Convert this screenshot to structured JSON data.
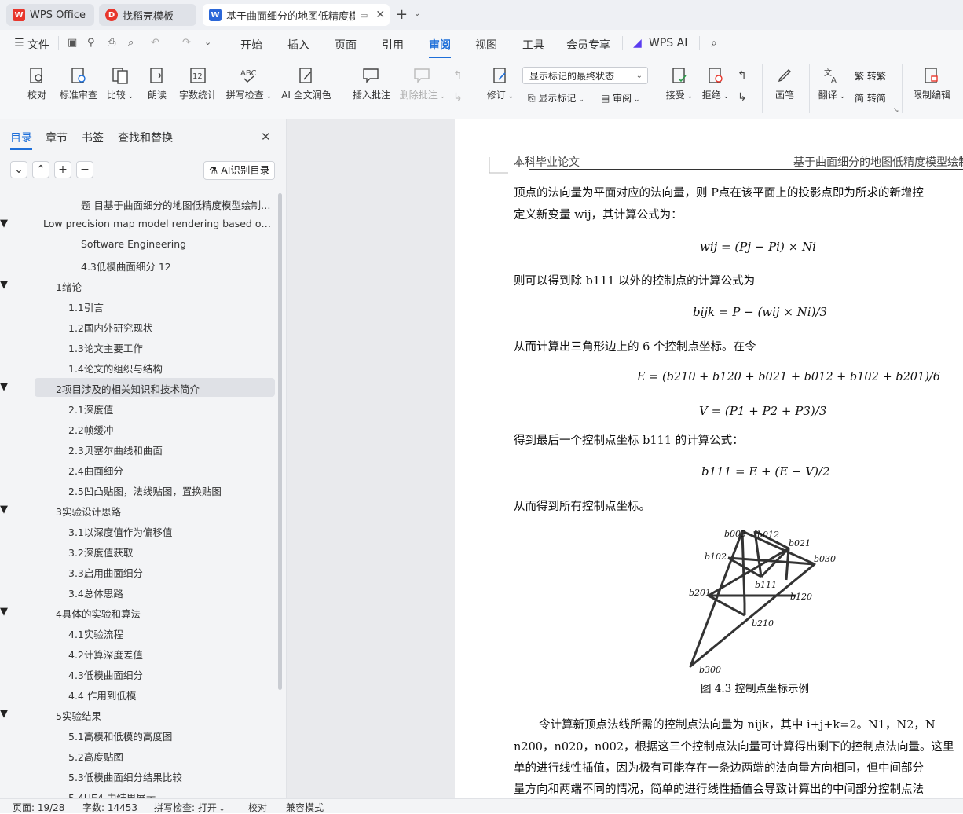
{
  "tabs": [
    {
      "label": "WPS Office",
      "icon": "wps-logo-icon"
    },
    {
      "label": "找稻壳模板",
      "icon": "docer-icon"
    },
    {
      "label": "基于曲面细分的地图低精度模",
      "icon": "word-doc-icon"
    }
  ],
  "menubar": {
    "file_label": "文件",
    "items": [
      "开始",
      "插入",
      "页面",
      "引用",
      "审阅",
      "视图",
      "工具",
      "会员专享"
    ],
    "active": "审阅",
    "wps_ai": "WPS AI"
  },
  "ribbon": {
    "proofread": "校对",
    "standard_review": "标准审查",
    "compare": "比较",
    "read_aloud": "朗读",
    "word_count": "字数统计",
    "spell_check": "拼写检查",
    "ai_polish": "AI 全文润色",
    "insert_comment": "插入批注",
    "delete_comment": "删除批注",
    "track_changes": "修订",
    "show_markup_select": "显示标记的最终状态",
    "show_markup": "显示标记",
    "review": "审阅",
    "accept": "接受",
    "reject": "拒绝",
    "pen": "画笔",
    "translate": "翻译",
    "to_traditional": "转繁",
    "to_simplified": "转简",
    "restrict_edit": "限制编辑"
  },
  "panel": {
    "tabs": [
      "目录",
      "章节",
      "书签",
      "查找和替换"
    ],
    "ai_toc": "AI识别目录",
    "toc": [
      {
        "label": "题 目基于曲面细分的地图低精度模型绘制及...",
        "level": 2,
        "arrow": false
      },
      {
        "label": "Low precision map model rendering based on s...",
        "level": 0,
        "arrow": true
      },
      {
        "label": "Software Engineering",
        "level": 2,
        "arrow": false
      },
      {
        "label": "4.3低模曲面细分 12",
        "level": 2,
        "arrow": false
      },
      {
        "label": "1绪论",
        "level": 1,
        "arrow": true
      },
      {
        "label": "1.1引言",
        "level": 3,
        "arrow": false
      },
      {
        "label": "1.2国内外研究现状",
        "level": 3,
        "arrow": false
      },
      {
        "label": "1.3论文主要工作",
        "level": 3,
        "arrow": false
      },
      {
        "label": "1.4论文的组织与结构",
        "level": 3,
        "arrow": false
      },
      {
        "label": "2项目涉及的相关知识和技术简介",
        "level": 1,
        "arrow": true
      },
      {
        "label": "2.1深度值",
        "level": 3,
        "arrow": false
      },
      {
        "label": "2.2帧缓冲",
        "level": 3,
        "arrow": false
      },
      {
        "label": "2.3贝塞尔曲线和曲面",
        "level": 3,
        "arrow": false
      },
      {
        "label": "2.4曲面细分",
        "level": 3,
        "arrow": false
      },
      {
        "label": "2.5凹凸贴图，法线贴图，置换贴图",
        "level": 3,
        "arrow": false
      },
      {
        "label": "3实验设计思路",
        "level": 1,
        "arrow": true
      },
      {
        "label": "3.1以深度值作为偏移值",
        "level": 3,
        "arrow": false
      },
      {
        "label": "3.2深度值获取",
        "level": 3,
        "arrow": false
      },
      {
        "label": "3.3启用曲面细分",
        "level": 3,
        "arrow": false
      },
      {
        "label": "3.4总体思路",
        "level": 3,
        "arrow": false
      },
      {
        "label": "4具体的实验和算法",
        "level": 1,
        "arrow": true
      },
      {
        "label": "4.1实验流程",
        "level": 3,
        "arrow": false
      },
      {
        "label": "4.2计算深度差值",
        "level": 3,
        "arrow": false
      },
      {
        "label": "4.3低模曲面细分",
        "level": 3,
        "arrow": false
      },
      {
        "label": "4.4 作用到低模",
        "level": 3,
        "arrow": false
      },
      {
        "label": "5实验结果",
        "level": 1,
        "arrow": true
      },
      {
        "label": "5.1高模和低模的高度图",
        "level": 3,
        "arrow": false
      },
      {
        "label": "5.2高度贴图",
        "level": 3,
        "arrow": false
      },
      {
        "label": "5.3低模曲面细分结果比较",
        "level": 3,
        "arrow": false
      },
      {
        "label": "5.4UE4 中结果展示",
        "level": 3,
        "arrow": false
      }
    ],
    "selected_index": 9
  },
  "doc": {
    "header_left": "本科毕业论文",
    "header_right": "基于曲面细分的地图低精度模型绘制",
    "p1_line1": "顶点的法向量为平面对应的法向量，则 P点在该平面上的投影点即为所求的新增控",
    "p1_line2": "定义新变量 wij，其计算公式为：",
    "eq1": "wij = (Pj − Pi) × Ni",
    "p2": "则可以得到除 b111 以外的控制点的计算公式为",
    "eq2": "bijk = P − (wij × Ni)/3",
    "p3": "从而计算出三角形边上的 6 个控制点坐标。在令",
    "eq3": "E = (b210 + b120 + b021 + b012 + b102 + b201)/6",
    "eq4": "V = (P1 + P2 + P3)/3",
    "p4": "得到最后一个控制点坐标 b111 的计算公式：",
    "eq5": "b111 = E + (E − V)/2",
    "p5": "从而得到所有控制点坐标。",
    "figure_labels": [
      "b003",
      "b012",
      "b021",
      "b030",
      "b102",
      "b111",
      "b120",
      "b201",
      "b210",
      "b300"
    ],
    "caption": "图 4.3   控制点坐标示例",
    "p6_line1": "令计算新顶点法线所需的控制点法向量为 nijk，其中 i+j+k=2。N1，N2，N",
    "p6_line2": "n200，n020，n002，根据这三个控制点法向量可计算得出剩下的控制点法向量。这里",
    "p6_line3": "单的进行线性插值，因为极有可能存在一条边两端的法向量方向相同，但中间部分",
    "p6_line4": "量方向和两端不同的情况，简单的进行线性插值会导致计算出的中间部分控制点法"
  },
  "status": {
    "page": "页面: 19/28",
    "words": "字数: 14453",
    "spell": "拼写检查: 打开",
    "proof": "校对",
    "compat": "兼容模式"
  },
  "colors": {
    "accent": "#1e6fd9",
    "wps_red": "#e8362c"
  }
}
